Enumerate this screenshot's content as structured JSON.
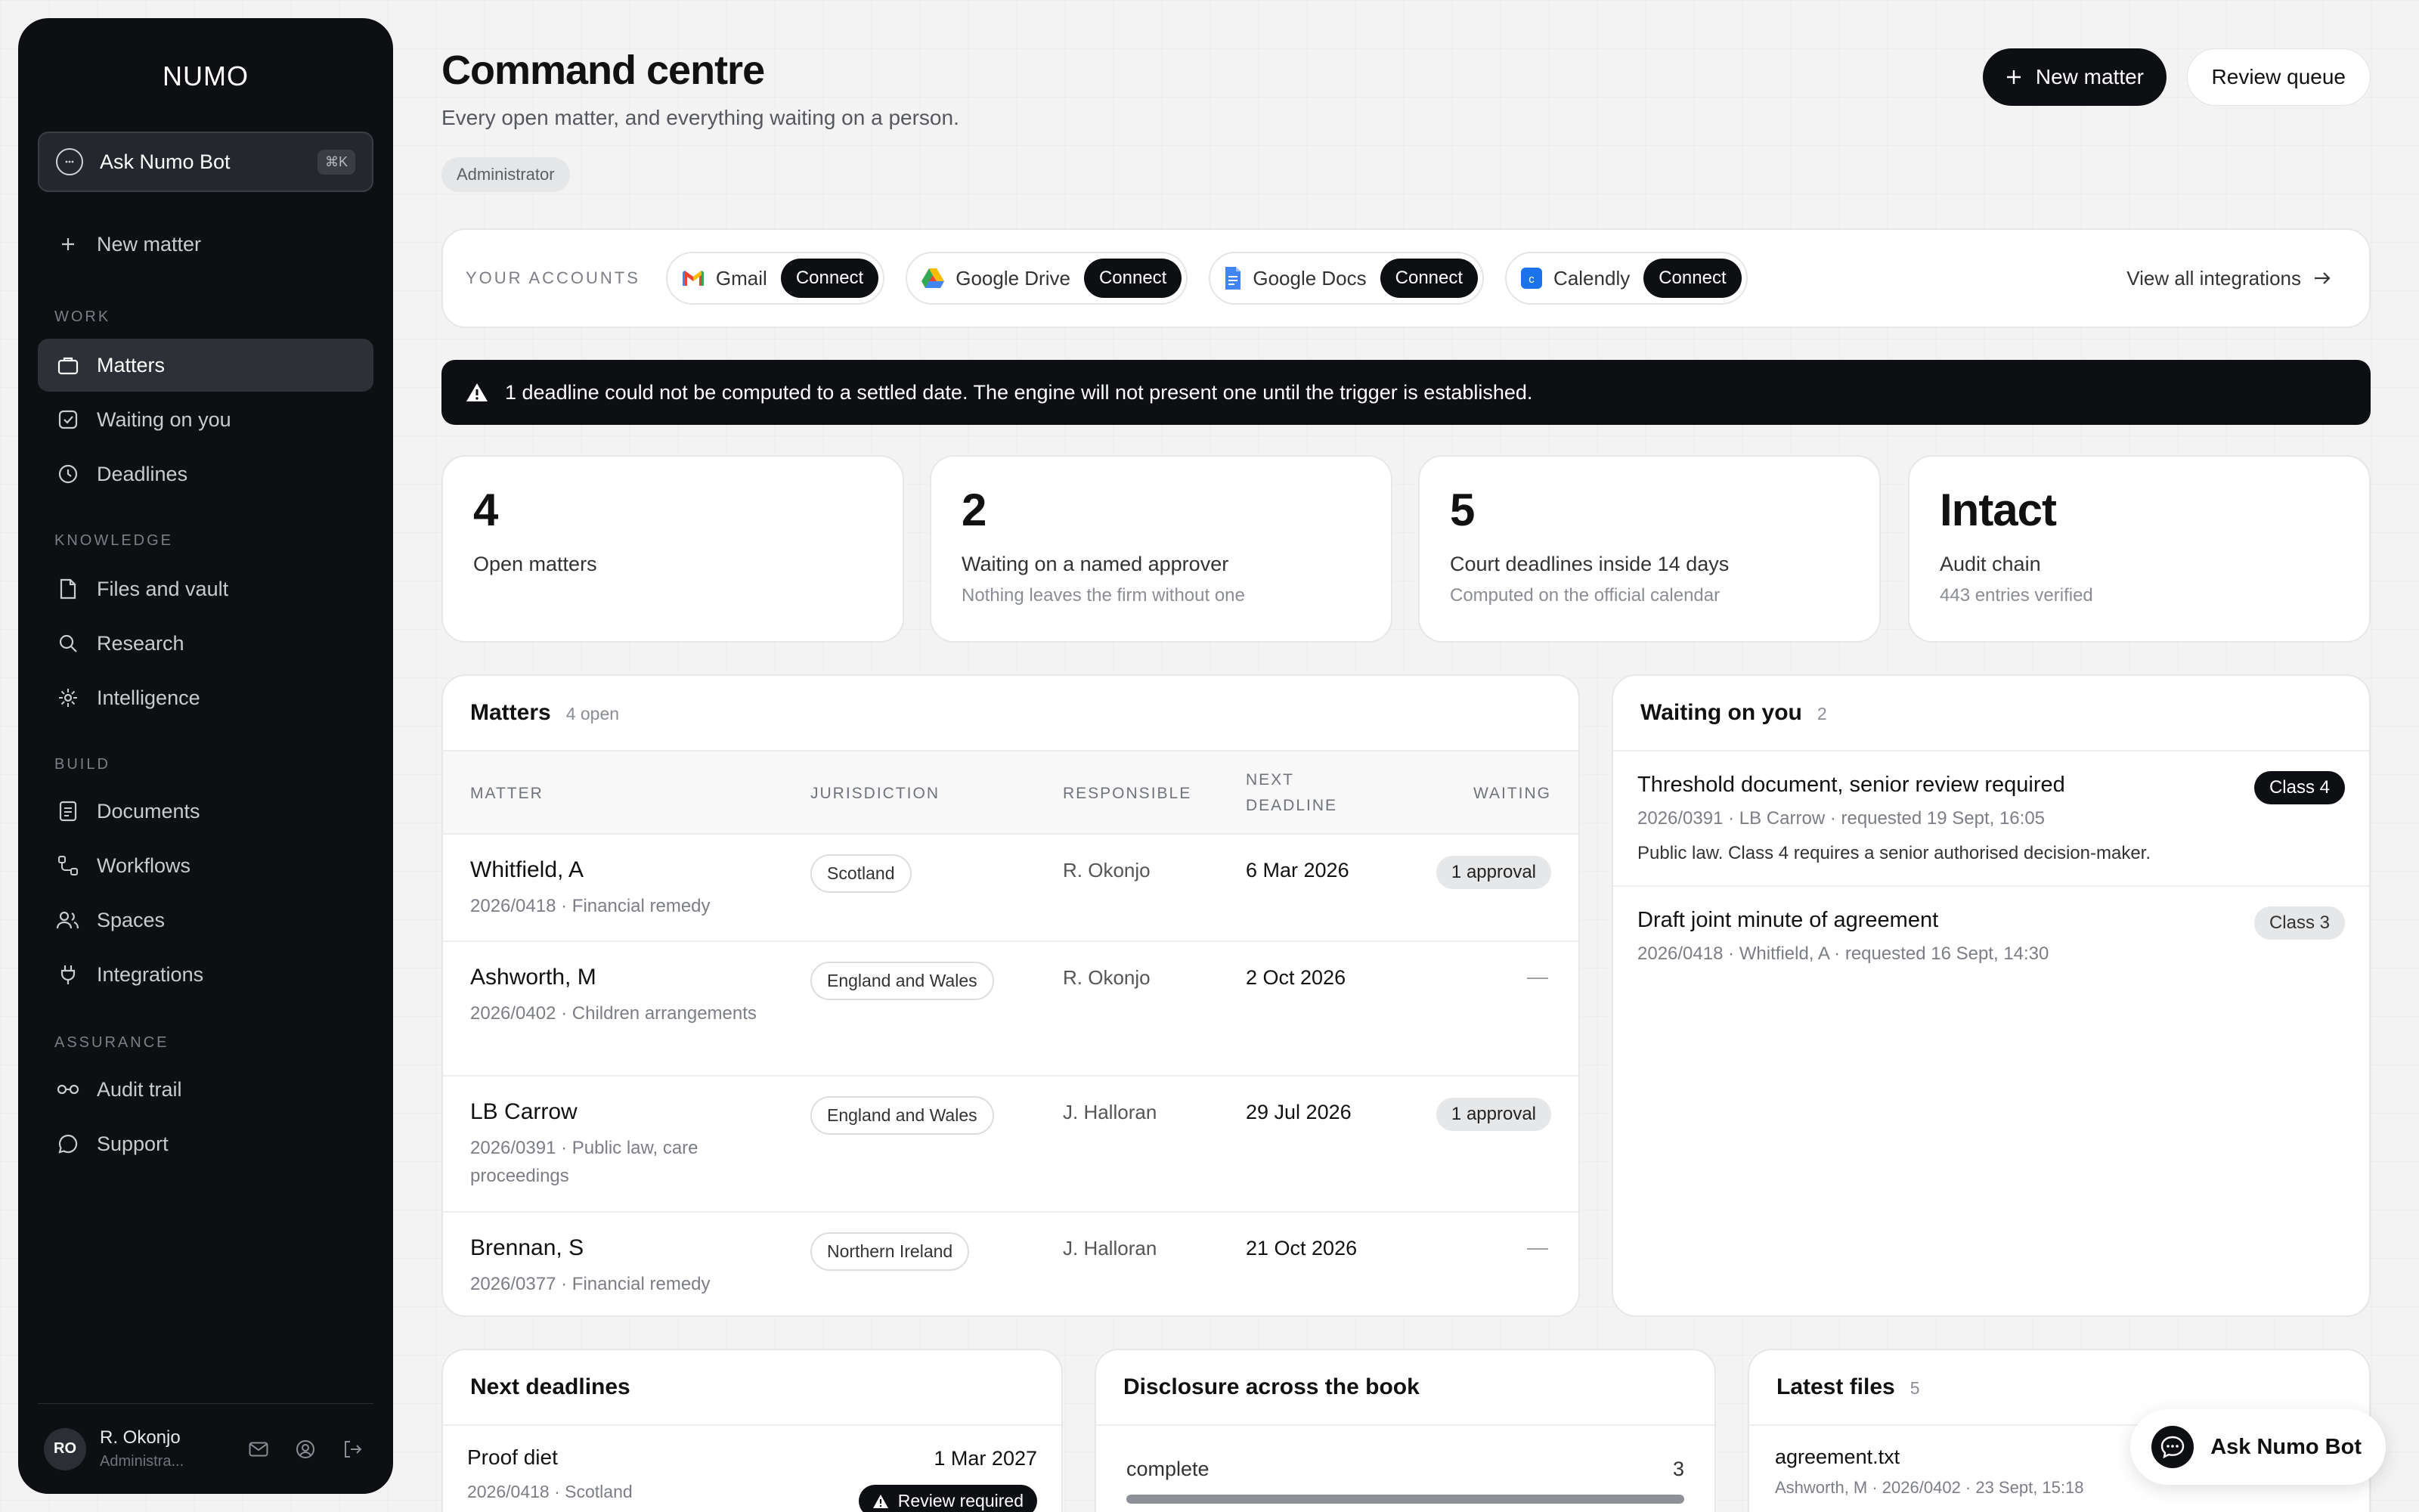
{
  "sidebar": {
    "logo": "NUMO",
    "ask_bot": {
      "label": "Ask Numo Bot",
      "shortcut": "⌘K"
    },
    "new_matter": "New matter",
    "sections": {
      "work": "WORK",
      "knowledge": "KNOWLEDGE",
      "build": "BUILD",
      "assurance": "ASSURANCE"
    },
    "items": {
      "matters": "Matters",
      "waiting": "Waiting on you",
      "deadlines": "Deadlines",
      "files": "Files and vault",
      "research": "Research",
      "intelligence": "Intelligence",
      "documents": "Documents",
      "workflows": "Workflows",
      "spaces": "Spaces",
      "integrations": "Integrations",
      "audit": "Audit trail",
      "support": "Support"
    },
    "user": {
      "initials": "RO",
      "name": "R. Okonjo",
      "role": "Administra..."
    }
  },
  "header": {
    "title": "Command centre",
    "subtitle": "Every open matter, and everything waiting on a person.",
    "role": "Administrator",
    "new_matter": "New matter",
    "review_queue": "Review queue"
  },
  "accounts": {
    "label": "YOUR ACCOUNTS",
    "items": [
      {
        "name": "Gmail",
        "action": "Connect"
      },
      {
        "name": "Google Drive",
        "action": "Connect"
      },
      {
        "name": "Google Docs",
        "action": "Connect"
      },
      {
        "name": "Calendly",
        "action": "Connect"
      }
    ],
    "view_all": "View all integrations"
  },
  "alert": "1 deadline could not be computed to a settled date. The engine will not present one until the trigger is established.",
  "stats": [
    {
      "value": "4",
      "label": "Open matters",
      "sub": ""
    },
    {
      "value": "2",
      "label": "Waiting on a named approver",
      "sub": "Nothing leaves the firm without one"
    },
    {
      "value": "5",
      "label": "Court deadlines inside 14 days",
      "sub": "Computed on the official calendar"
    },
    {
      "value": "Intact",
      "label": "Audit chain",
      "sub": "443 entries verified"
    }
  ],
  "matters": {
    "title": "Matters",
    "count": "4 open",
    "columns": {
      "matter": "MATTER",
      "jurisdiction": "JURISDICTION",
      "responsible": "RESPONSIBLE",
      "next_deadline_1": "NEXT",
      "next_deadline_2": "DEADLINE",
      "waiting": "WAITING"
    },
    "rows": [
      {
        "name": "Whitfield, A",
        "meta": "2026/0418 · Financial remedy",
        "jurisdiction": "Scotland",
        "responsible": "R. Okonjo",
        "deadline": "6 Mar 2026",
        "waiting": "1 approval"
      },
      {
        "name": "Ashworth, M",
        "meta": "2026/0402 · Children arrangements",
        "jurisdiction": "England and Wales",
        "responsible": "R. Okonjo",
        "deadline": "2 Oct 2026",
        "waiting": "—"
      },
      {
        "name": "LB Carrow",
        "meta": "2026/0391 · Public law, care proceedings",
        "jurisdiction": "England and Wales",
        "responsible": "J. Halloran",
        "deadline": "29 Jul 2026",
        "waiting": "1 approval"
      },
      {
        "name": "Brennan, S",
        "meta": "2026/0377 · Financial remedy",
        "jurisdiction": "Northern Ireland",
        "responsible": "J. Halloran",
        "deadline": "21 Oct 2026",
        "waiting": "—"
      }
    ]
  },
  "waiting": {
    "title": "Waiting on you",
    "count": "2",
    "items": [
      {
        "title": "Threshold document, senior review required",
        "meta": "2026/0391 · LB Carrow · requested 19 Sept, 16:05",
        "desc": "Public law. Class 4 requires a senior authorised decision-maker.",
        "class": "Class 4"
      },
      {
        "title": "Draft joint minute of agreement",
        "meta": "2026/0418 · Whitfield, A · requested 16 Sept, 14:30",
        "desc": "",
        "class": "Class 3"
      }
    ]
  },
  "next_deadlines": {
    "title": "Next deadlines",
    "items": [
      {
        "title": "Proof diet",
        "date": "1 Mar 2027",
        "meta": "2026/0418 · Scotland",
        "badge": "Review required"
      }
    ]
  },
  "disclosure": {
    "title": "Disclosure across the book",
    "rows": [
      {
        "label": "complete",
        "value": "3",
        "fraction": 1.0
      }
    ]
  },
  "files": {
    "title": "Latest files",
    "count": "5",
    "items": [
      {
        "name": "agreement.txt",
        "meta": "Ashworth, M · 2026/0402 · 23 Sept, 15:18"
      }
    ]
  },
  "fab": "Ask Numo Bot"
}
